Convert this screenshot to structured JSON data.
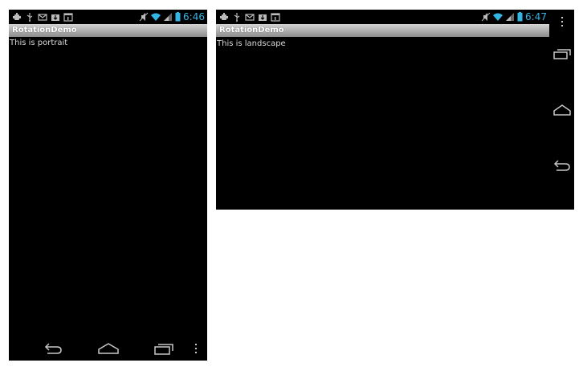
{
  "portrait": {
    "status": {
      "time": "6:46"
    },
    "app_title": "RotationDemo",
    "content_text": "This is portrait"
  },
  "landscape": {
    "status": {
      "time": "6:47"
    },
    "app_title": "RotationDemo",
    "content_text": "This is landscape"
  },
  "status_icons_left": [
    "usb-debug-icon",
    "usb-icon",
    "email-icon",
    "download-icon",
    "calendar-icon"
  ],
  "status_icons_right": [
    "mute-icon",
    "wifi-icon",
    "signal-icon",
    "battery-icon"
  ],
  "nav_buttons": [
    "back-icon",
    "home-icon",
    "recent-apps-icon",
    "menu-icon"
  ],
  "colors": {
    "clock": "#33b5e5",
    "screen": "#000000",
    "actionbar_top": "#d4d4d4",
    "actionbar_bottom": "#8c8c8c",
    "content_text": "#d9d9d9",
    "nav_icon": "#c8c8c8"
  }
}
